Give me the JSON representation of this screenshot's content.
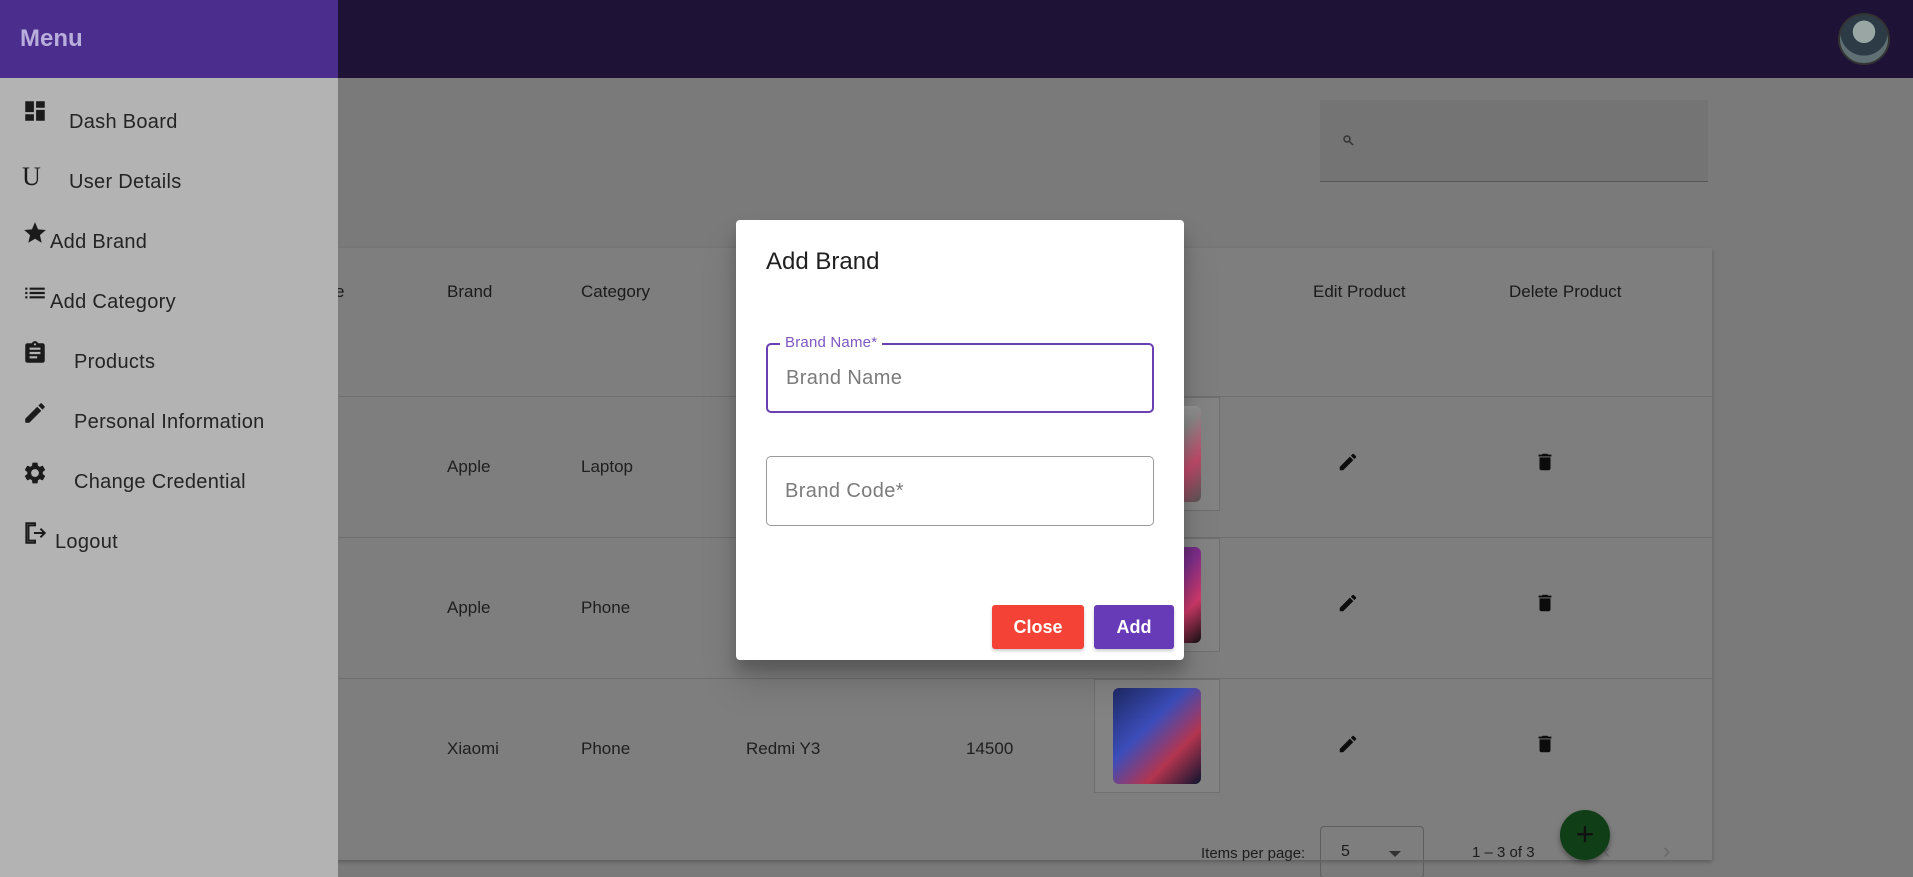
{
  "sidebar": {
    "title": "Menu",
    "items": [
      {
        "label": "Dash Board",
        "icon": "dashboard-icon"
      },
      {
        "label": "User Details",
        "icon": "u-letter-icon"
      },
      {
        "label": "Add Brand",
        "icon": "star-icon"
      },
      {
        "label": "Add Category",
        "icon": "list-icon"
      },
      {
        "label": "Products",
        "icon": "clipboard-icon"
      },
      {
        "label": "Personal Information",
        "icon": "pencil-icon"
      },
      {
        "label": "Change Credential",
        "icon": "gear-icon"
      },
      {
        "label": "Logout",
        "icon": "logout-icon"
      }
    ]
  },
  "table": {
    "headers": {
      "partial": "e",
      "brand": "Brand",
      "category": "Category",
      "edit": "Edit Product",
      "delete": "Delete Product"
    },
    "rows": [
      {
        "brand": "Apple",
        "category": "Laptop",
        "name": "",
        "price": ""
      },
      {
        "brand": "Apple",
        "category": "Phone",
        "name": "",
        "price": ""
      },
      {
        "brand": "Xiaomi",
        "category": "Phone",
        "name": "Redmi Y3",
        "price": "14500"
      }
    ]
  },
  "paginator": {
    "items_per_page_label": "Items per page:",
    "page_size": "5",
    "range": "1 – 3 of 3"
  },
  "dialog": {
    "title": "Add Brand",
    "brand_name": {
      "label": "Brand Name*",
      "placeholder": "Brand Name",
      "value": ""
    },
    "brand_code": {
      "placeholder": "Brand Code*",
      "value": ""
    },
    "close_label": "Close",
    "add_label": "Add"
  },
  "colors": {
    "toolbar": "#1e1236",
    "sidebar_header": "#4a2d8c",
    "accent": "#673ab7",
    "close_button": "#f44336",
    "fab": "#0f3e17"
  }
}
